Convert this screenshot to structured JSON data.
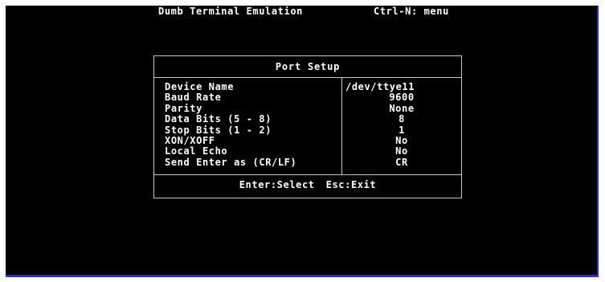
{
  "titlebar": {
    "title": "Dumb Terminal Emulation",
    "hint": "Ctrl-N: menu"
  },
  "dialog": {
    "title": "Port Setup",
    "settings": [
      {
        "label": "Device Name",
        "value": "/dev/ttye11"
      },
      {
        "label": "Baud Rate",
        "value": "9600"
      },
      {
        "label": "Parity",
        "value": "None"
      },
      {
        "label": "Data Bits (5 - 8)",
        "value": "8"
      },
      {
        "label": "Stop Bits (1 - 2)",
        "value": "1"
      },
      {
        "label": "XON/XOFF",
        "value": "No"
      },
      {
        "label": "Local Echo",
        "value": "No"
      },
      {
        "label": "Send Enter as (CR/LF)",
        "value": "CR"
      }
    ],
    "footer": {
      "select_hint": "Enter:Select",
      "exit_hint": "Esc:Exit"
    }
  },
  "colors": {
    "background": "#000000",
    "text": "#ffffff",
    "border": "#c8c8c8",
    "screen_edge": "#2a2ed8"
  }
}
